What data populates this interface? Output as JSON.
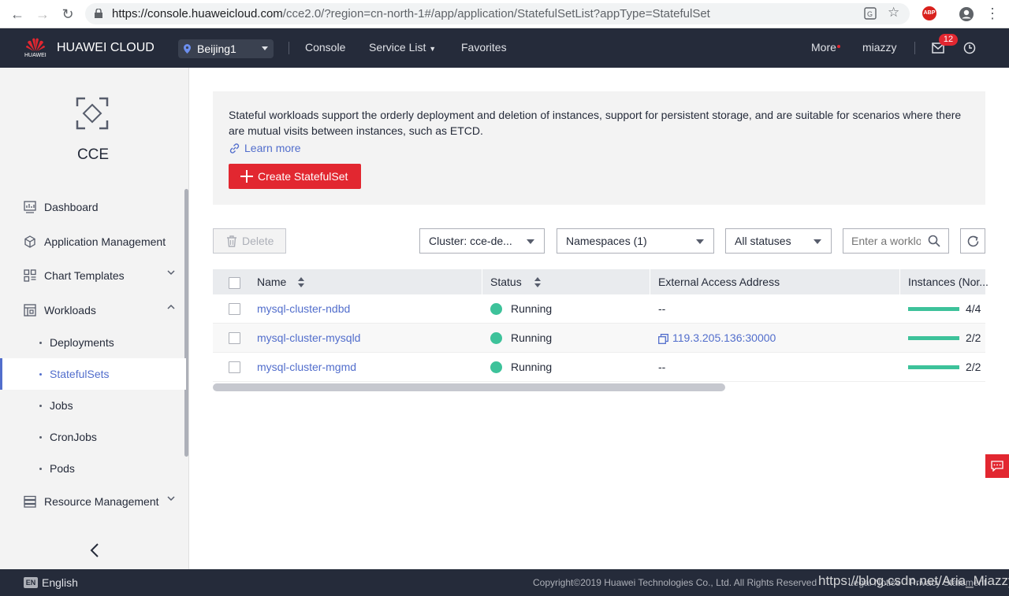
{
  "browser": {
    "url_host": "https://console.huaweicloud.com",
    "url_path": "/cce2.0/?region=cn-north-1#/app/application/StatefulSetList?appType=StatefulSet",
    "abp_label": "ABP"
  },
  "topbar": {
    "logo_text": "HUAWEI",
    "brand": "HUAWEI CLOUD",
    "region": "Beijing1",
    "console": "Console",
    "service_list": "Service List",
    "favorites": "Favorites",
    "more": "More",
    "user": "miazzy",
    "mail_count": "12"
  },
  "sidebar": {
    "service_name": "CCE",
    "items": [
      {
        "label": "Dashboard"
      },
      {
        "label": "Application Management"
      },
      {
        "label": "Chart Templates"
      },
      {
        "label": "Workloads"
      }
    ],
    "subitems": [
      {
        "label": "Deployments"
      },
      {
        "label": "StatefulSets"
      },
      {
        "label": "Jobs"
      },
      {
        "label": "CronJobs"
      },
      {
        "label": "Pods"
      }
    ],
    "resource_management": "Resource Management"
  },
  "info": {
    "description": "Stateful workloads support the orderly deployment and deletion of instances, support for persistent storage, and are suitable for scenarios where there are mutual visits between instances, such as ETCD.",
    "learn_more": "Learn more",
    "create_button": "Create StatefulSet"
  },
  "toolbar": {
    "delete": "Delete",
    "cluster": "Cluster: cce-de...",
    "namespaces": "Namespaces (1)",
    "statuses": "All statuses",
    "search_placeholder": "Enter a workload name"
  },
  "table": {
    "headers": [
      "Name",
      "Status",
      "External Access Address",
      "Instances (Nor..."
    ],
    "rows": [
      {
        "name": "mysql-cluster-ndbd",
        "status": "Running",
        "address": "--",
        "instances": "4/4",
        "ready_fraction": 1.0
      },
      {
        "name": "mysql-cluster-mysqld",
        "status": "Running",
        "address": "119.3.205.136:30000",
        "instances": "2/2",
        "ready_fraction": 1.0
      },
      {
        "name": "mysql-cluster-mgmd",
        "status": "Running",
        "address": "--",
        "instances": "2/2",
        "ready_fraction": 1.0
      }
    ]
  },
  "footer": {
    "lang_badge": "EN",
    "language": "English",
    "copyright": "Copyright©2019 Huawei Technologies Co., Ltd. All Rights Reserved",
    "legal_notice": "Legal Notice",
    "privacy": "Privacy Statement",
    "watermark": "https://blog.csdn.net/Aria_Miazzy"
  },
  "colors": {
    "topbar": "#252b3a",
    "accent_red": "#e22730",
    "link_blue": "#526ecc",
    "running_green": "#3dc29a"
  },
  "icons": [
    "back-icon",
    "forward-icon",
    "reload-icon",
    "lock-icon",
    "translate-icon",
    "star-icon",
    "account-icon",
    "menu-dots-icon",
    "huawei-logo",
    "location-icon",
    "mail-icon",
    "clock-icon",
    "cce-icon",
    "dashboard-icon",
    "app-management-icon",
    "chart-templates-icon",
    "workloads-icon",
    "resource-management-icon",
    "collapse-icon",
    "link-icon",
    "plus-icon",
    "trash-icon",
    "search-icon",
    "refresh-icon",
    "sort-icon",
    "running-icon",
    "copy-icon",
    "feedback-icon"
  ]
}
